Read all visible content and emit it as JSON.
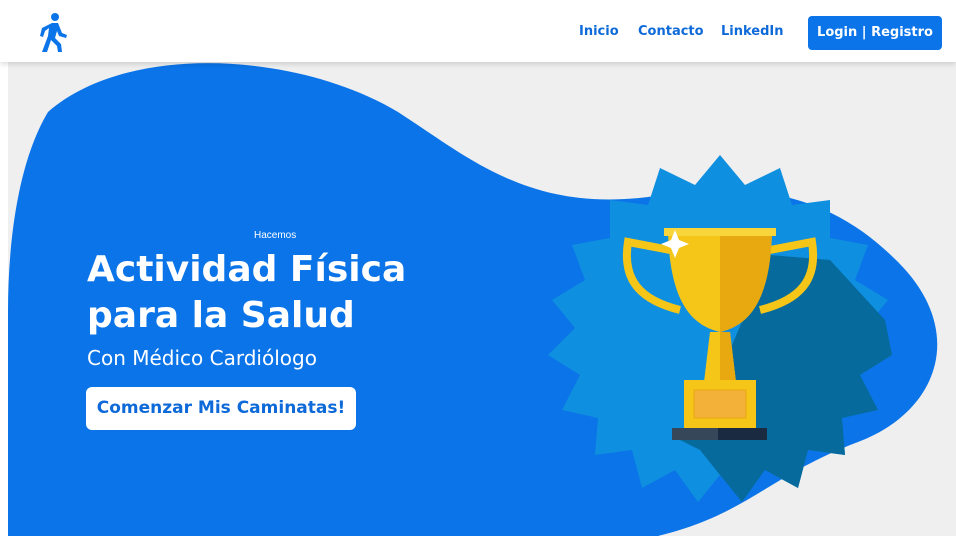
{
  "nav": {
    "logo_icon": "walking-person-icon",
    "links": [
      "Inicio",
      "Contacto",
      "LinkedIn"
    ],
    "login_label": "Login | Registro"
  },
  "hero": {
    "kicker": "Hacemos",
    "title_line1": "Actividad Física",
    "title_line2": "para la Salud",
    "subtitle": "Con Médico Cardiólogo",
    "cta_label": "Comenzar Mis Caminatas!",
    "illustration": "trophy-icon"
  },
  "colors": {
    "brand_blue": "#0a74e8",
    "badge_blue": "#0f8fe0",
    "shadow_blue": "#066a9c",
    "trophy_gold": "#f5c518",
    "background_gray": "#efefef"
  }
}
